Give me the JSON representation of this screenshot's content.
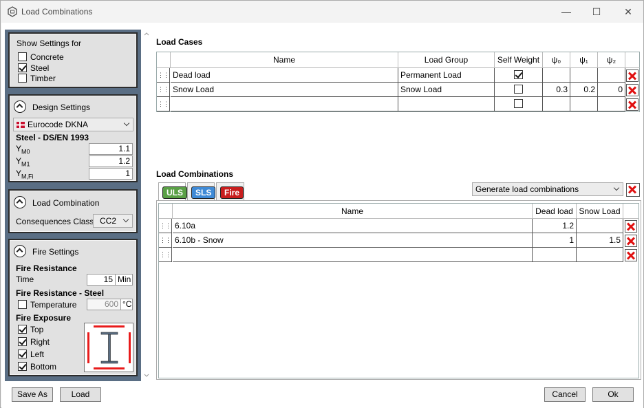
{
  "window": {
    "title": "Load Combinations",
    "minimize": "—",
    "maximize": "☐",
    "close": "✕"
  },
  "show_settings": {
    "title": "Show Settings for",
    "items": [
      {
        "label": "Concrete",
        "checked": false
      },
      {
        "label": "Steel",
        "checked": true
      },
      {
        "label": "Timber",
        "checked": false
      }
    ]
  },
  "design_settings": {
    "title": "Design Settings",
    "code_select": "Eurocode DKNA",
    "standard": "Steel - DS/EN 1993",
    "gammas": [
      {
        "sym": "Y",
        "sub": "M0",
        "value": "1.1"
      },
      {
        "sym": "Y",
        "sub": "M1",
        "value": "1.2"
      },
      {
        "sym": "Y",
        "sub": "M,Fi",
        "value": "1"
      }
    ]
  },
  "load_combination_panel": {
    "title": "Load Combination",
    "consequences_label": "Consequences Class",
    "consequences_value": "CC2"
  },
  "fire_settings": {
    "title": "Fire Settings",
    "resistance_heading": "Fire Resistance",
    "time_label": "Time",
    "time_value": "15",
    "time_unit": "Min",
    "steel_heading": "Fire Resistance - Steel",
    "temperature_label": "Temperature",
    "temperature_value": "600",
    "temperature_unit": "°C",
    "exposure_heading": "Fire Exposure",
    "exposure": [
      {
        "label": "Top",
        "checked": true
      },
      {
        "label": "Right",
        "checked": true
      },
      {
        "label": "Left",
        "checked": true
      },
      {
        "label": "Bottom",
        "checked": true
      }
    ]
  },
  "load_cases": {
    "title": "Load Cases",
    "columns": [
      "Name",
      "Load Group",
      "Self Weight",
      "ψ₀",
      "ψ₁",
      "ψ₂"
    ],
    "rows": [
      {
        "name": "Dead load",
        "group": "Permanent Load",
        "self_weight": true,
        "psi0": "",
        "psi1": "",
        "psi2": ""
      },
      {
        "name": "Snow Load",
        "group": "Snow Load",
        "self_weight": false,
        "psi0": "0.3",
        "psi1": "0.2",
        "psi2": "0"
      },
      {
        "name": "",
        "group": "",
        "self_weight": false,
        "psi0": "",
        "psi1": "",
        "psi2": ""
      }
    ]
  },
  "load_combinations": {
    "title": "Load Combinations",
    "tabs": [
      {
        "label": "ULS",
        "color": "#5aa046"
      },
      {
        "label": "SLS",
        "color": "#3f8ad6"
      },
      {
        "label": "Fire",
        "color": "#c81e1e"
      }
    ],
    "generate_select": "Generate load combinations",
    "columns": [
      "Name",
      "Dead load",
      "Snow Load"
    ],
    "rows": [
      {
        "name": "6.10a",
        "dead": "1.2",
        "snow": ""
      },
      {
        "name": "6.10b - Snow",
        "dead": "1",
        "snow": "1.5"
      },
      {
        "name": "",
        "dead": "",
        "snow": ""
      }
    ]
  },
  "footer": {
    "save_as": "Save As",
    "load": "Load",
    "cancel": "Cancel",
    "ok": "Ok"
  },
  "colors": {
    "panel_bg": "#5a6e84",
    "delete_red": "#e01010",
    "fire_red": "#e81b1b"
  }
}
